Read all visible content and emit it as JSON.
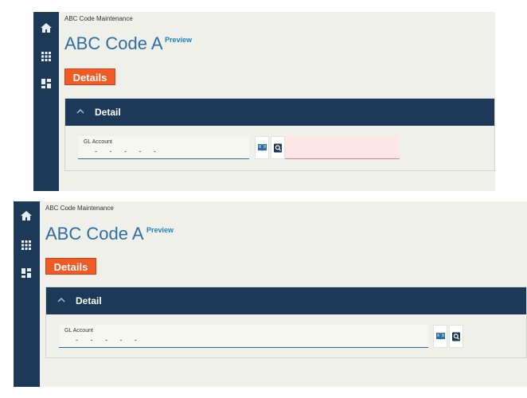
{
  "panels": [
    {
      "breadcrumb": "ABC Code Maintenance",
      "title": "ABC Code A",
      "preview": "Preview",
      "details_button": "Details",
      "section_title": "Detail",
      "gl_label": "GL Account",
      "gl_value": "-   -   -   -   -"
    },
    {
      "breadcrumb": "ABC Code Maintenance",
      "title": "ABC Code A",
      "preview": "Preview",
      "details_button": "Details",
      "section_title": "Detail",
      "gl_label": "GL Account",
      "gl_value": "-   -   -   -   -"
    }
  ],
  "icons": {
    "nav": [
      "home-icon",
      "apps-grid-icon",
      "dashboard-icon"
    ],
    "field_buttons": [
      "book-lookup-icon",
      "search-icon"
    ]
  },
  "colors": {
    "nav_rail": "#1c3a57",
    "accent_orange": "#f05a24",
    "title_blue": "#2e6da4",
    "error_field": "#fde6e5"
  }
}
